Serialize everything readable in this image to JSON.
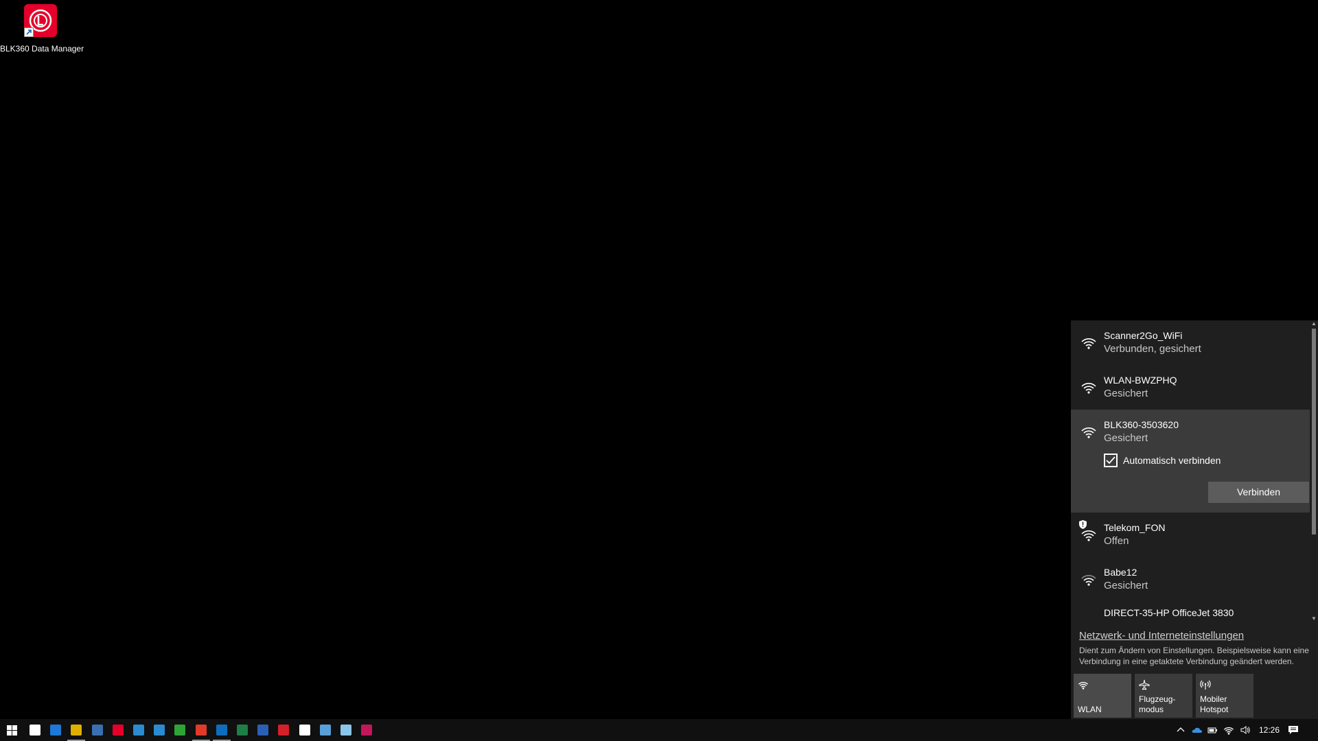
{
  "desktop": {
    "icons": [
      {
        "label": "BLK360 Data Manager",
        "icon": "blk360-app-icon",
        "accent": "#e4002b"
      }
    ]
  },
  "network_flyout": {
    "networks": [
      {
        "ssid": "Scanner2Go_WiFi",
        "status": "Verbunden, gesichert",
        "icon": "wifi-icon"
      },
      {
        "ssid": "WLAN-BWZPHQ",
        "status": "Gesichert",
        "icon": "wifi-icon"
      },
      {
        "ssid": "BLK360-3503620",
        "status": "Gesichert",
        "icon": "wifi-icon",
        "expanded": true,
        "auto_connect_label": "Automatisch verbinden",
        "auto_connect_checked": true,
        "connect_button": "Verbinden"
      },
      {
        "ssid": "Telekom_FON",
        "status": "Offen",
        "icon": "wifi-open-icon"
      },
      {
        "ssid": "Babe12",
        "status": "Gesichert",
        "icon": "wifi-icon"
      },
      {
        "ssid": "DIRECT-35-HP OfficeJet 3830",
        "status": "",
        "icon": "wifi-icon"
      }
    ],
    "settings_link": "Netzwerk- und Interneteinstellungen",
    "settings_description": "Dient zum Ändern von Einstellungen. Beispielsweise kann eine Verbindung in eine getaktete Verbindung geändert werden.",
    "quick_actions": [
      {
        "label": "WLAN",
        "icon": "wifi-icon",
        "active": true
      },
      {
        "label": "Flugzeug-\nmodus",
        "icon": "airplane-icon",
        "active": false
      },
      {
        "label": "Mobiler\nHotspot",
        "icon": "hotspot-icon",
        "active": false
      }
    ]
  },
  "taskbar": {
    "apps": [
      {
        "name": "task-view",
        "color": "#ffffff"
      },
      {
        "name": "edge",
        "color": "#1e78d7"
      },
      {
        "name": "chrome",
        "color": "#e0b000",
        "running": true
      },
      {
        "name": "app-grid",
        "color": "#3a6fb0"
      },
      {
        "name": "blk360",
        "color": "#e4002b"
      },
      {
        "name": "scanner-s-1",
        "color": "#2a8bd0"
      },
      {
        "name": "scanner-s-2",
        "color": "#2a8bd0"
      },
      {
        "name": "green-c",
        "color": "#2fa335"
      },
      {
        "name": "red-s",
        "color": "#e23a2a",
        "running": true
      },
      {
        "name": "outlook",
        "color": "#0f6cbd",
        "running": true
      },
      {
        "name": "excel",
        "color": "#1e7e45"
      },
      {
        "name": "word",
        "color": "#2b5fb4"
      },
      {
        "name": "opera",
        "color": "#d4202a"
      },
      {
        "name": "document",
        "color": "#ffffff"
      },
      {
        "name": "paint",
        "color": "#5aa0d8"
      },
      {
        "name": "notepad",
        "color": "#8ac6e8"
      },
      {
        "name": "grid-app",
        "color": "#c2185b"
      }
    ],
    "tray": {
      "time": "12:26"
    }
  }
}
